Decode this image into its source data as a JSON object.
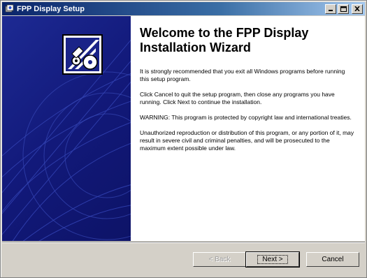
{
  "window": {
    "title": "FPP Display Setup"
  },
  "wizard": {
    "heading": "Welcome to the FPP Display Installation Wizard",
    "paragraphs": [
      "It is strongly recommended that you exit all Windows programs before running this setup program.",
      "Click Cancel to quit the setup program, then close any programs you have running.  Click Next to continue the installation.",
      "WARNING: This program is protected by copyright law and international treaties.",
      "Unauthorized reproduction or distribution of this program, or any portion of it, may result in severe civil and criminal penalties, and will be prosecuted to the maximum extent possible under law."
    ]
  },
  "buttons": {
    "back": "< Back",
    "next": "Next >",
    "cancel": "Cancel"
  },
  "colors": {
    "side_panel": "#1d2a93",
    "title_bar": "#0a246a",
    "dialog_face": "#d4d0c8"
  }
}
